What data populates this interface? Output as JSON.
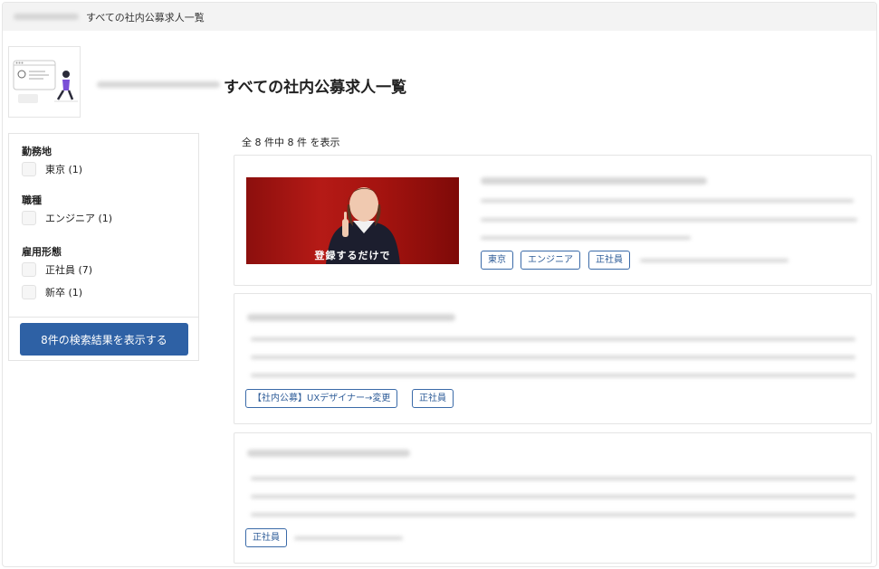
{
  "breadcrumb": {
    "current": "すべての社内公募求人一覧"
  },
  "header": {
    "title": "すべての社内公募求人一覧"
  },
  "filters": {
    "groups": [
      {
        "title": "勤務地",
        "options": [
          {
            "label": "東京 (1)"
          }
        ]
      },
      {
        "title": "職種",
        "options": [
          {
            "label": "エンジニア (1)"
          }
        ]
      },
      {
        "title": "雇用形態",
        "options": [
          {
            "label": "正社員 (7)"
          },
          {
            "label": "新卒 (1)"
          }
        ]
      }
    ],
    "search_button": "8件の検索結果を表示する"
  },
  "results": {
    "count_text": "全 8 件中 8 件 を表示",
    "cards": [
      {
        "banner_text": "登録するだけで",
        "tags": [
          "東京",
          "エンジニア",
          "正社員"
        ]
      },
      {
        "tags": [
          "【社内公募】UXデザイナー→変更",
          "正社員"
        ]
      },
      {
        "tags": [
          "正社員"
        ]
      }
    ]
  }
}
